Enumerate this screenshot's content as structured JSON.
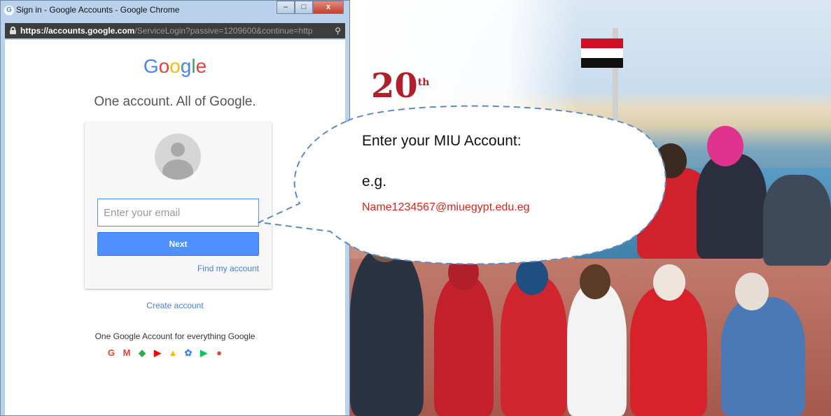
{
  "window": {
    "title": "Sign in - Google Accounts - Google Chrome",
    "minimize": "–",
    "maximize": "□",
    "close": "x",
    "url_host": "https://accounts.google.com",
    "url_path": "/ServiceLogin?passive=1209600&continue=http"
  },
  "signin": {
    "logo": "Google",
    "tagline": "One account. All of Google.",
    "email_placeholder": "Enter your email",
    "next_label": "Next",
    "find_account": "Find my account",
    "create_account": "Create account",
    "everything": "One Google Account for everything Google",
    "apps": [
      {
        "icon": "G",
        "color": "#ea4335"
      },
      {
        "icon": "M",
        "color": "#d44638"
      },
      {
        "icon": "◆",
        "color": "#34a853"
      },
      {
        "icon": "▶",
        "color": "#ff0000"
      },
      {
        "icon": "▲",
        "color": "#fbbc05"
      },
      {
        "icon": "✿",
        "color": "#4285f4"
      },
      {
        "icon": "▶",
        "color": "#00c853"
      },
      {
        "icon": "●",
        "color": "#db4437"
      }
    ]
  },
  "bubble": {
    "line1": "Enter your MIU Account:",
    "line2": "e.g.",
    "example": "Name1234567@miuegypt.edu.eg"
  },
  "photo": {
    "logo_text": "20",
    "logo_sup": "th"
  },
  "colors": {
    "accent_blue": "#4d90fe",
    "link_blue": "#427fed",
    "example_red": "#e2231a"
  }
}
